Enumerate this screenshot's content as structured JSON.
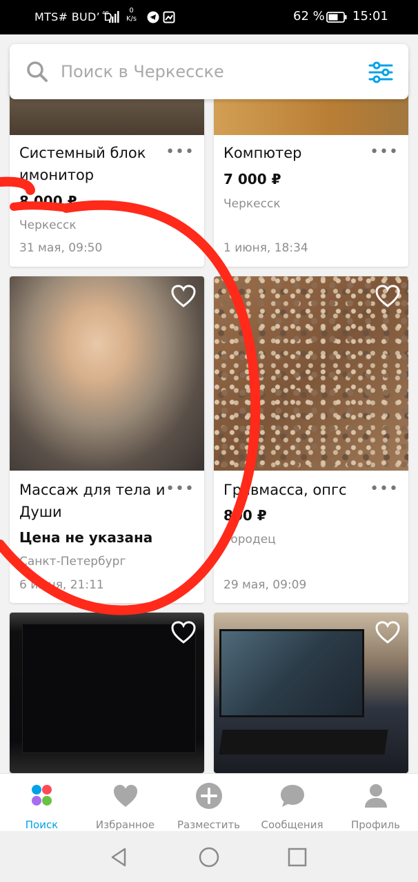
{
  "status_bar": {
    "carrier": "MTS# BUD’ D",
    "network_type": "4G",
    "speed_value": "0",
    "speed_unit": "K/s",
    "battery": "62 %",
    "time": "15:01"
  },
  "search": {
    "placeholder": "Поиск в Черкесске",
    "icon": "search-icon",
    "filter_icon": "sliders-icon"
  },
  "listings": [
    {
      "title": "Системный блок имонитор",
      "price": "8 000 ₽",
      "location": "Черкесск",
      "date": "31 мая, 09:50"
    },
    {
      "title": "Компютер",
      "price": "7 000 ₽",
      "location": "Черкесск",
      "date": "1 июня, 18:34"
    },
    {
      "title": "Массаж для тела и Души",
      "price": "Цена не указана",
      "location": "Санкт-Петербург",
      "date": "6 июня, 21:11"
    },
    {
      "title": "Гравмасса, опгс",
      "price": "800 ₽",
      "location": "Городец",
      "date": "29 мая, 09:09"
    },
    {
      "title": "",
      "price": "",
      "location": "",
      "date": ""
    },
    {
      "title": "",
      "price": "",
      "location": "",
      "date": ""
    }
  ],
  "bottom_nav": {
    "items": [
      {
        "label": "Поиск",
        "icon": "search-dots-icon",
        "active": true
      },
      {
        "label": "Избранное",
        "icon": "heart-icon",
        "active": false
      },
      {
        "label": "Разместить",
        "icon": "plus-circle-icon",
        "active": false
      },
      {
        "label": "Сообщения",
        "icon": "chat-bubble-icon",
        "active": false
      },
      {
        "label": "Профиль",
        "icon": "profile-icon",
        "active": false
      }
    ]
  },
  "colors": {
    "accent": "#00a2e8",
    "annotation": "#ff2a1a",
    "nav_icon": "#a8a8a8"
  }
}
